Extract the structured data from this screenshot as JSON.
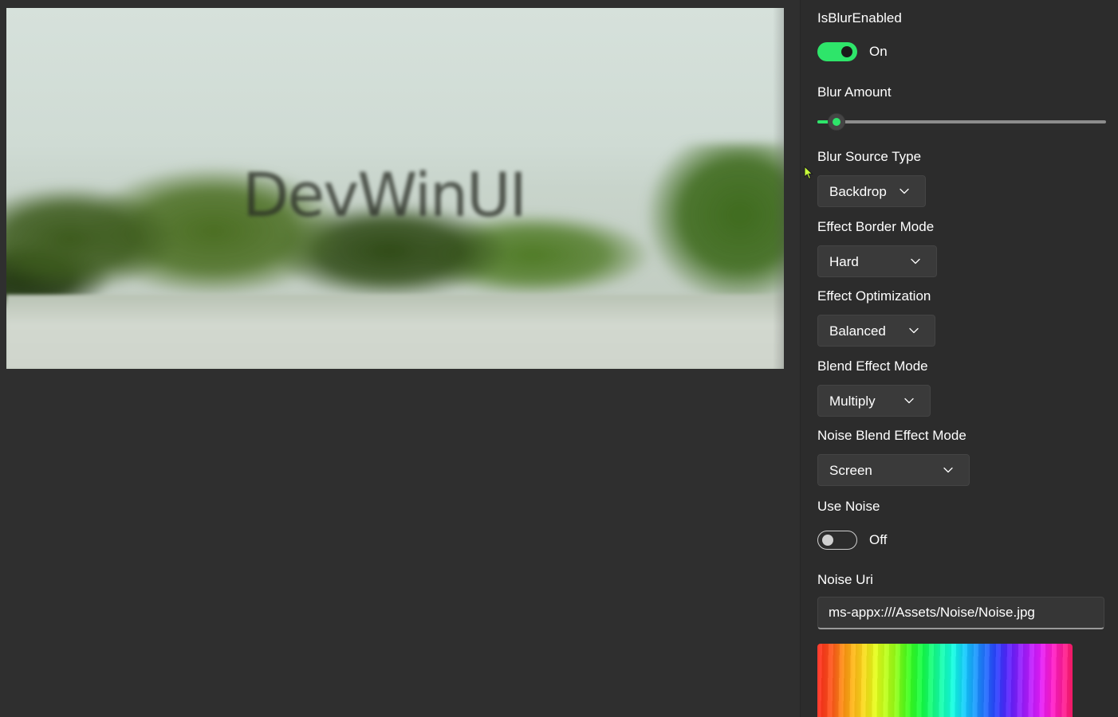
{
  "preview": {
    "watermark": "DevWinUI"
  },
  "settings": {
    "blur_enabled": {
      "label": "IsBlurEnabled",
      "state": "On",
      "on": true
    },
    "blur_amount": {
      "label": "Blur Amount",
      "value_fraction": 0.065
    },
    "blur_source": {
      "label": "Blur Source Type",
      "value": "Backdrop"
    },
    "border_mode": {
      "label": "Effect Border Mode",
      "value": "Hard"
    },
    "optimization": {
      "label": "Effect Optimization",
      "value": "Balanced"
    },
    "blend_mode": {
      "label": "Blend Effect Mode",
      "value": "Multiply"
    },
    "noise_blend_mode": {
      "label": "Noise Blend Effect Mode",
      "value": "Screen"
    },
    "use_noise": {
      "label": "Use Noise",
      "state": "Off",
      "on": false
    },
    "noise_uri": {
      "label": "Noise Uri",
      "value": "ms-appx:///Assets/Noise/Noise.jpg"
    }
  },
  "colors": {
    "accent": "#2ee56a",
    "background": "#2f2f2f",
    "panel": "#2c2c2c"
  },
  "icons": {
    "dropdown": "chevron-down-icon",
    "pointer": "mouse-cursor-icon"
  }
}
